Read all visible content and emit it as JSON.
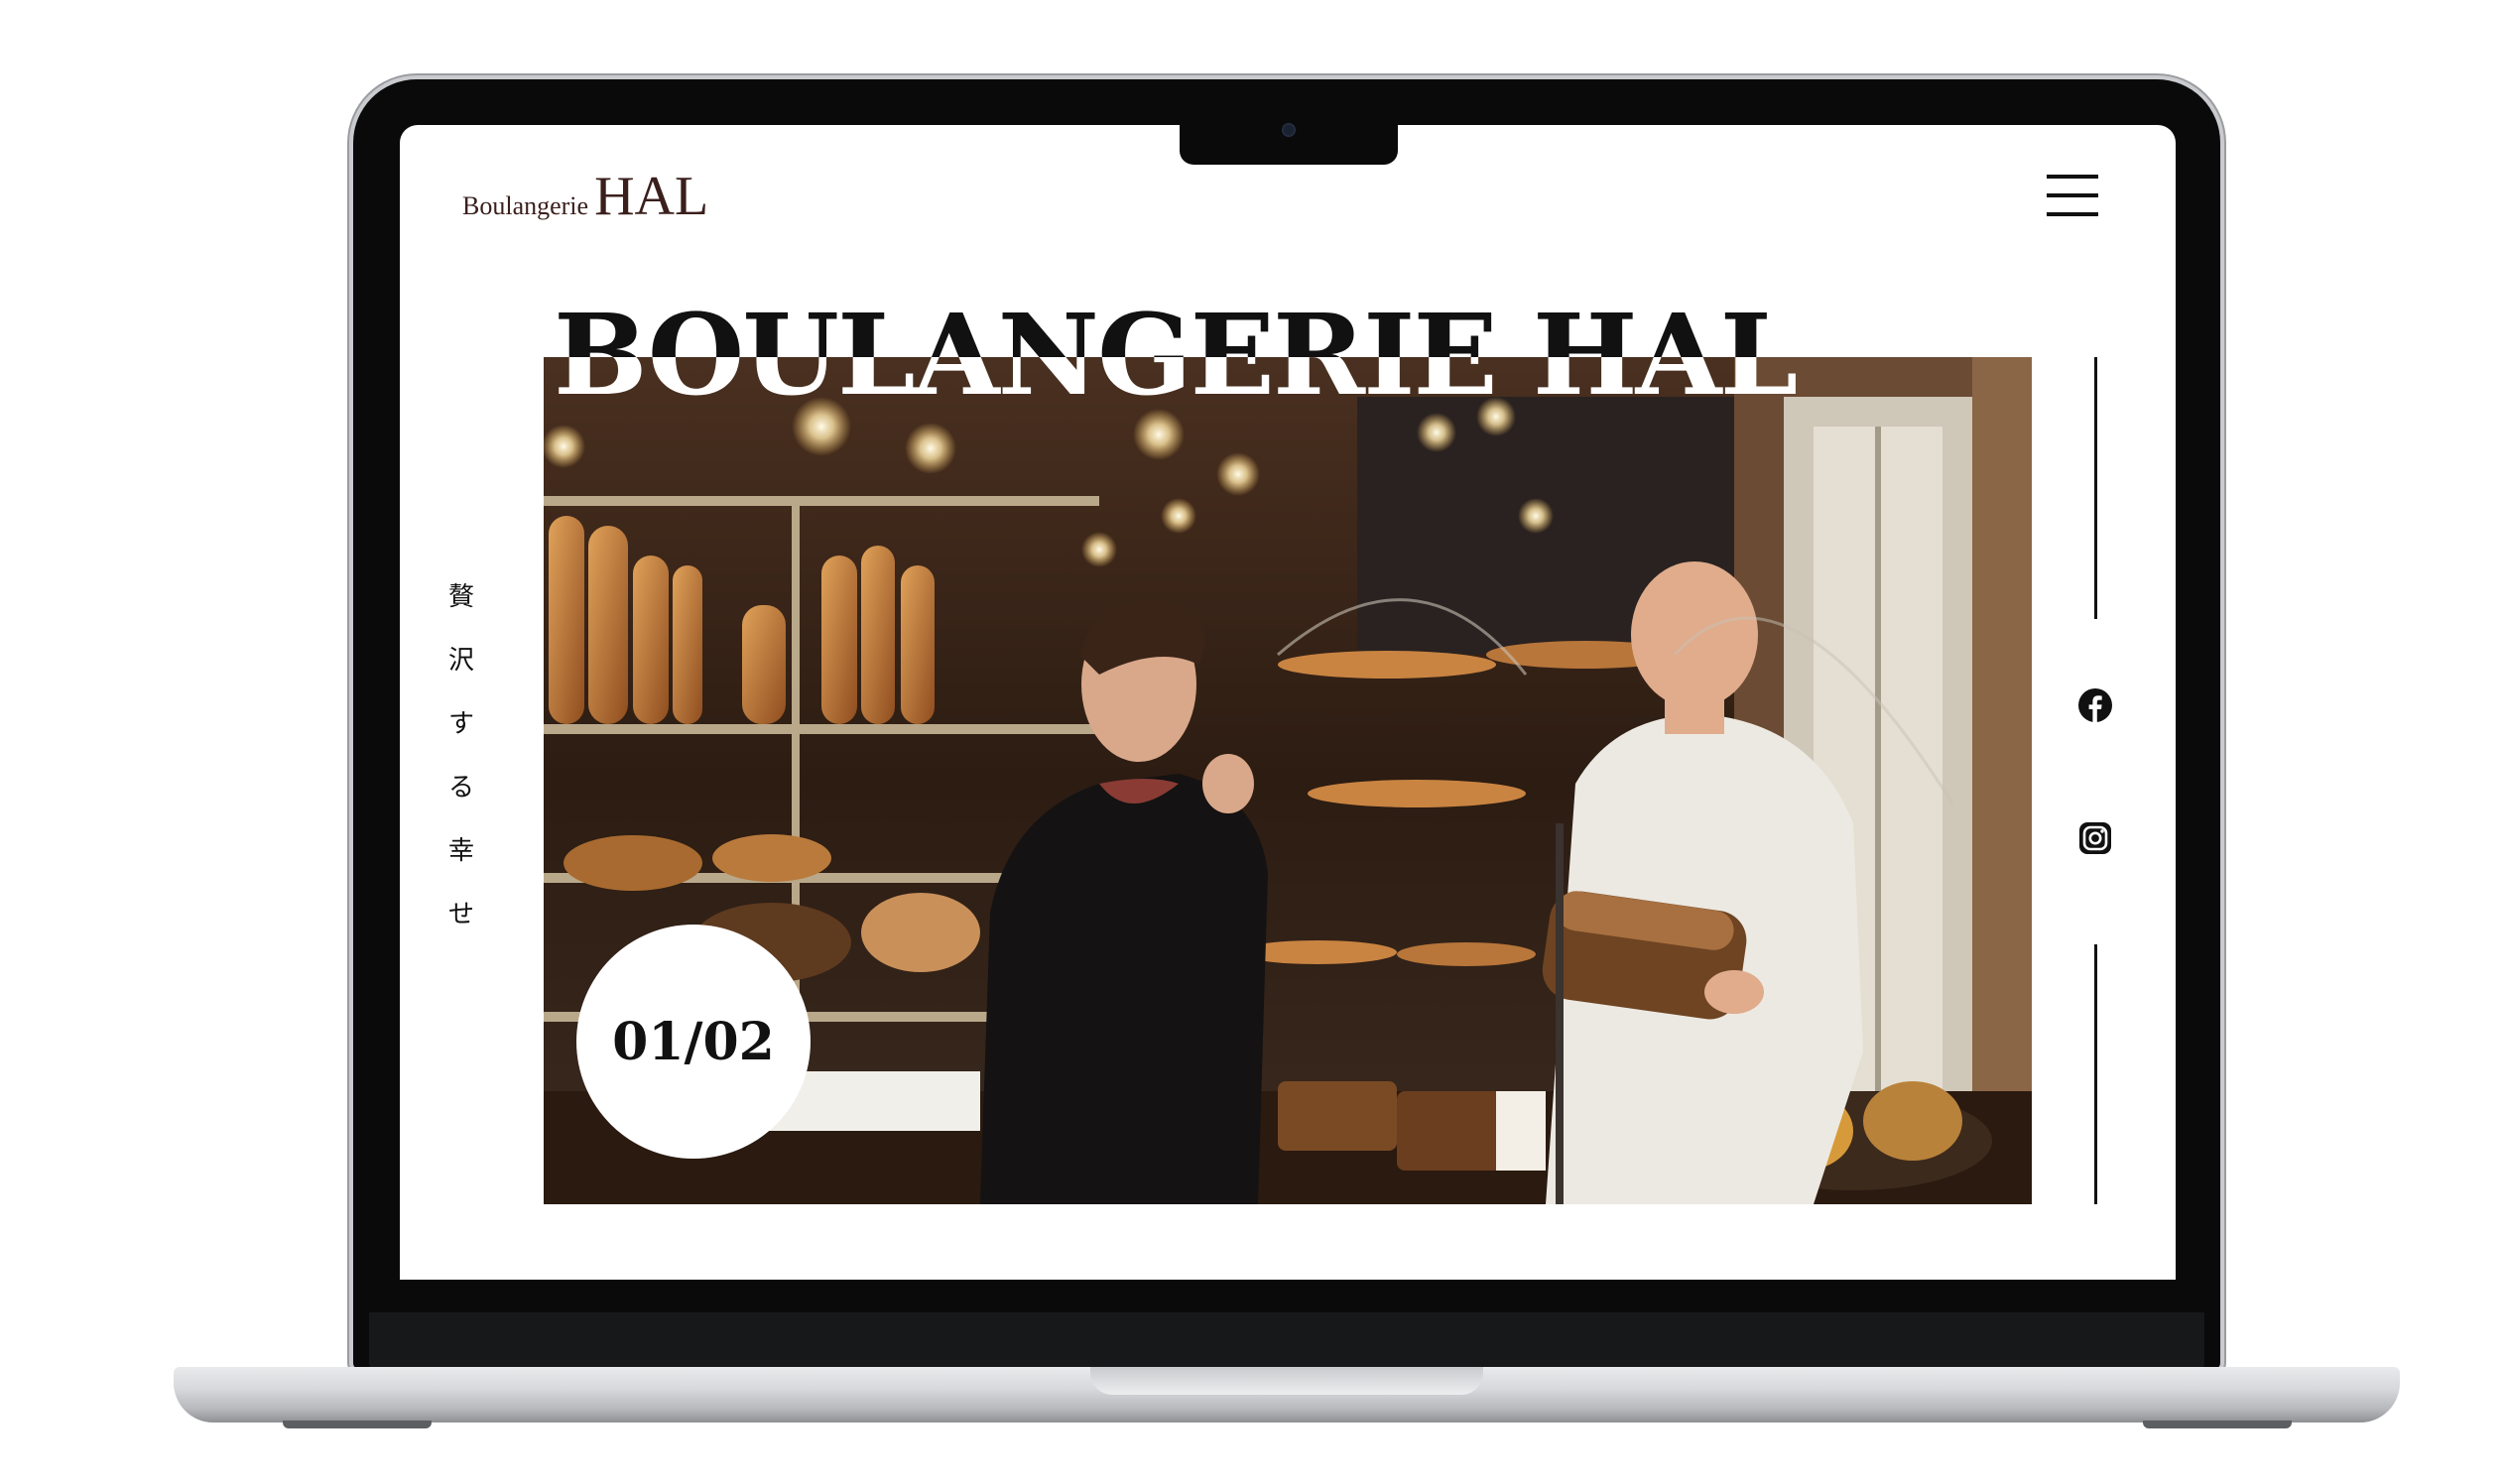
{
  "site": {
    "logo_small": "Boulangerie",
    "logo_big": "HAL",
    "hero_title": "BOULANGERIE HAL",
    "slide_counter": "01/02",
    "vertical_copy": [
      "贅",
      "沢",
      "す",
      "る",
      "幸",
      "せ"
    ]
  },
  "icons": {
    "menu": "hamburger-menu-icon",
    "facebook": "facebook-icon",
    "instagram": "instagram-icon"
  },
  "colors": {
    "logo": "#3a1f1c",
    "text": "#111111",
    "frame": "#0a0a0a",
    "background": "#ffffff"
  }
}
